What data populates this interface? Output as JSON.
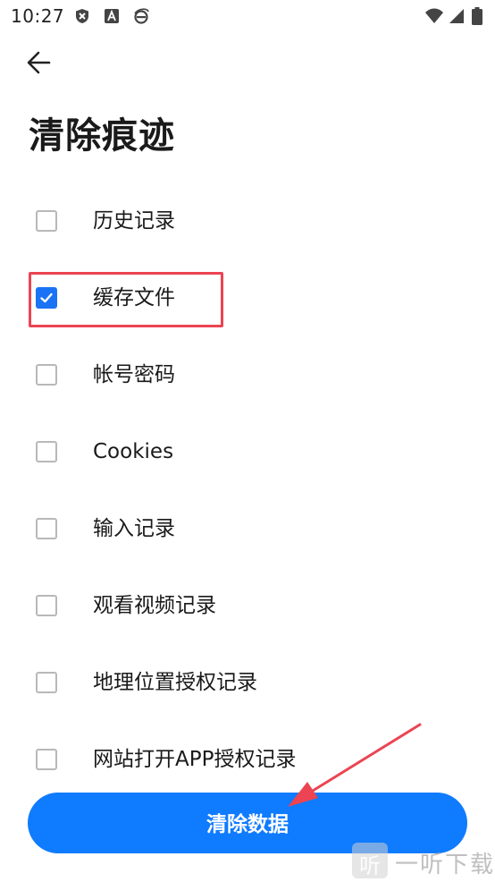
{
  "status_bar": {
    "time": "10:27",
    "icons_left": [
      "shield-icon",
      "font-a-icon",
      "browser-e-icon"
    ],
    "icons_right": [
      "wifi-icon",
      "signal-icon",
      "battery-icon"
    ]
  },
  "header": {
    "back_icon": "arrow-left-icon",
    "title": "清除痕迹"
  },
  "options": [
    {
      "label": "历史记录",
      "checked": false
    },
    {
      "label": "缓存文件",
      "checked": true
    },
    {
      "label": "帐号密码",
      "checked": false
    },
    {
      "label": "Cookies",
      "checked": false
    },
    {
      "label": "输入记录",
      "checked": false
    },
    {
      "label": "观看视频记录",
      "checked": false
    },
    {
      "label": "地理位置授权记录",
      "checked": false
    },
    {
      "label": "网站打开APP授权记录",
      "checked": false
    }
  ],
  "clear_button": {
    "label": "清除数据"
  },
  "watermark": {
    "text": "一听下载",
    "logo_text": "听"
  },
  "colors": {
    "accent": "#0f7bff",
    "checkbox_checked": "#1a73f5",
    "annotation": "#ec4452"
  }
}
